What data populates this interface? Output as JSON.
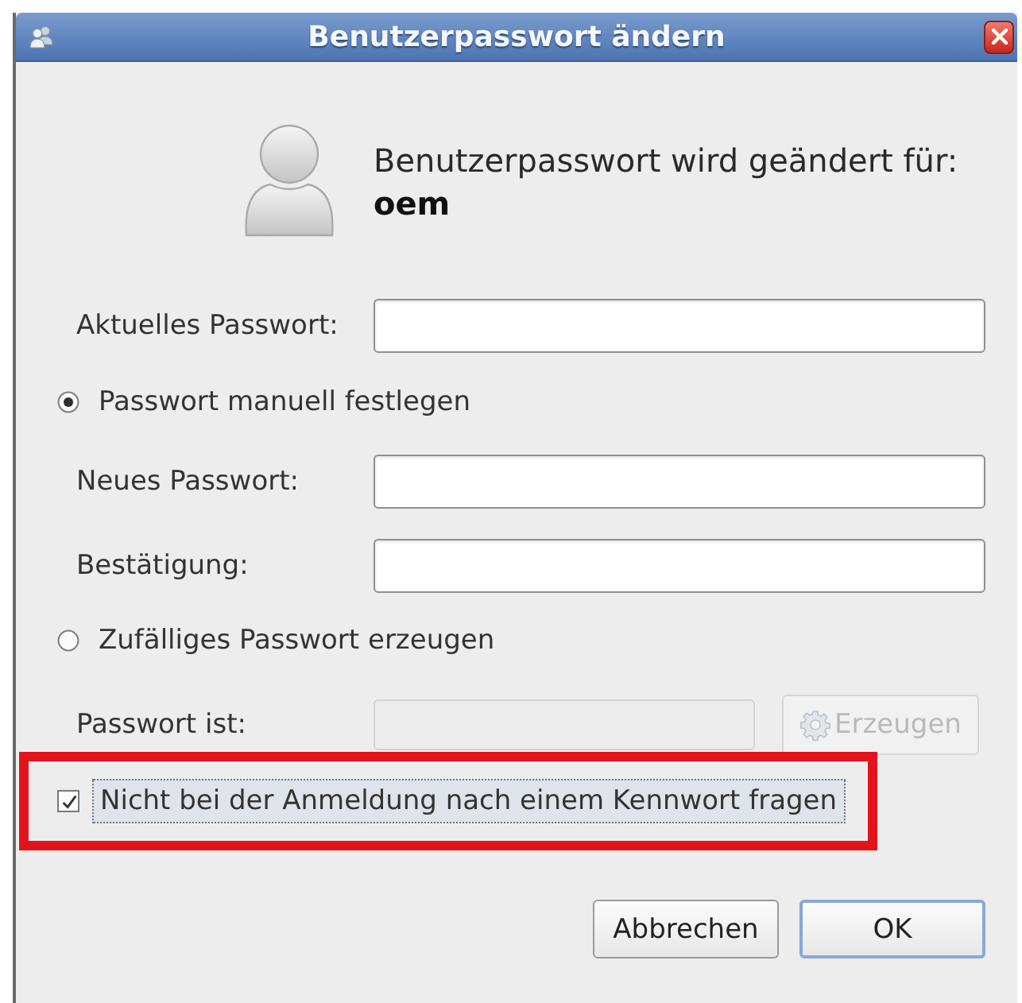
{
  "window": {
    "title": "Benutzerpasswort ändern"
  },
  "header": {
    "text": "Benutzerpasswort wird geändert für:",
    "user": "oem"
  },
  "rows": [
    {
      "kind": "field",
      "label": "Aktuelles Passwort:",
      "disabled": false
    },
    {
      "kind": "radio",
      "label": "Passwort manuell festlegen",
      "selected": true
    },
    {
      "kind": "field",
      "label": "Neues Passwort:",
      "disabled": false
    },
    {
      "kind": "field",
      "label": "Bestätigung:",
      "disabled": false
    },
    {
      "kind": "radio",
      "label": "Zufälliges Passwort erzeugen",
      "selected": false
    },
    {
      "kind": "generated",
      "label": "Passwort ist:",
      "disabled": true,
      "button": {
        "label": "Erzeugen",
        "disabled": true
      }
    },
    {
      "kind": "checkbox",
      "label": "Nicht bei der Anmeldung nach einem Kennwort fragen",
      "checked": true,
      "focused": true,
      "highlighted": true
    }
  ],
  "buttons": [
    {
      "label": "Abbrechen",
      "default": false
    },
    {
      "label": "OK",
      "default": true
    }
  ]
}
